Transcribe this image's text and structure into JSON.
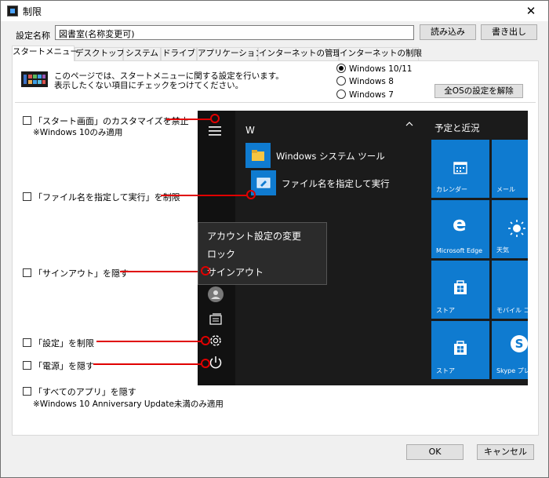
{
  "window": {
    "title": "制限",
    "close_glyph": "✕"
  },
  "setting_name": {
    "label": "設定名称",
    "value": "図書室(名称変更可)",
    "load_button": "読み込み",
    "export_button": "書き出し"
  },
  "tabs": [
    "スタートメニュー",
    "デスクトップ",
    "システム",
    "ドライブ",
    "アプリケーション",
    "インターネットの管理",
    "インターネットの制限"
  ],
  "active_tab": 0,
  "description": {
    "line1": "このページでは、スタートメニューに関する設定を行います。",
    "line2": "表示したくない項目にチェックをつけてください。"
  },
  "os_options": {
    "selected": "Windows 10/11",
    "options": [
      "Windows 10/11",
      "Windows 8",
      "Windows 7"
    ],
    "unset_all_button": "全OSの設定を解除"
  },
  "checkboxes": [
    {
      "label": "「スタート画面」のカスタマイズを禁止",
      "note": "※Windows 10のみ適用",
      "checked": false
    },
    {
      "label": "「ファイル名を指定して実行」を制限",
      "checked": false
    },
    {
      "label": "「サインアウト」を隠す",
      "checked": false
    },
    {
      "label": "「設定」を制限",
      "checked": false
    },
    {
      "label": "「電源」を隠す",
      "checked": false
    },
    {
      "label": "「すべてのアプリ」を隠す",
      "note": "※Windows 10 Anniversary Update未満のみ適用",
      "checked": false
    }
  ],
  "start_menu_preview": {
    "letter_header": "W",
    "group_title": "予定と近況",
    "folder": "Windows システム ツール",
    "run_item": "ファイル名を指定して実行",
    "context_menu": [
      "アカウント設定の変更",
      "ロック",
      "サインアウト"
    ],
    "tiles": [
      "カレンダー",
      "メール",
      "Microsoft Edge",
      "天気",
      "ストア",
      "モバイル コン",
      "ストア",
      "Skype プレビ"
    ],
    "colors": {
      "background": "#1b1b1b",
      "tile": "#0f7bd0",
      "marker": "#e00000"
    }
  },
  "footer": {
    "ok_button": "OK",
    "cancel_button": "キャンセル"
  }
}
